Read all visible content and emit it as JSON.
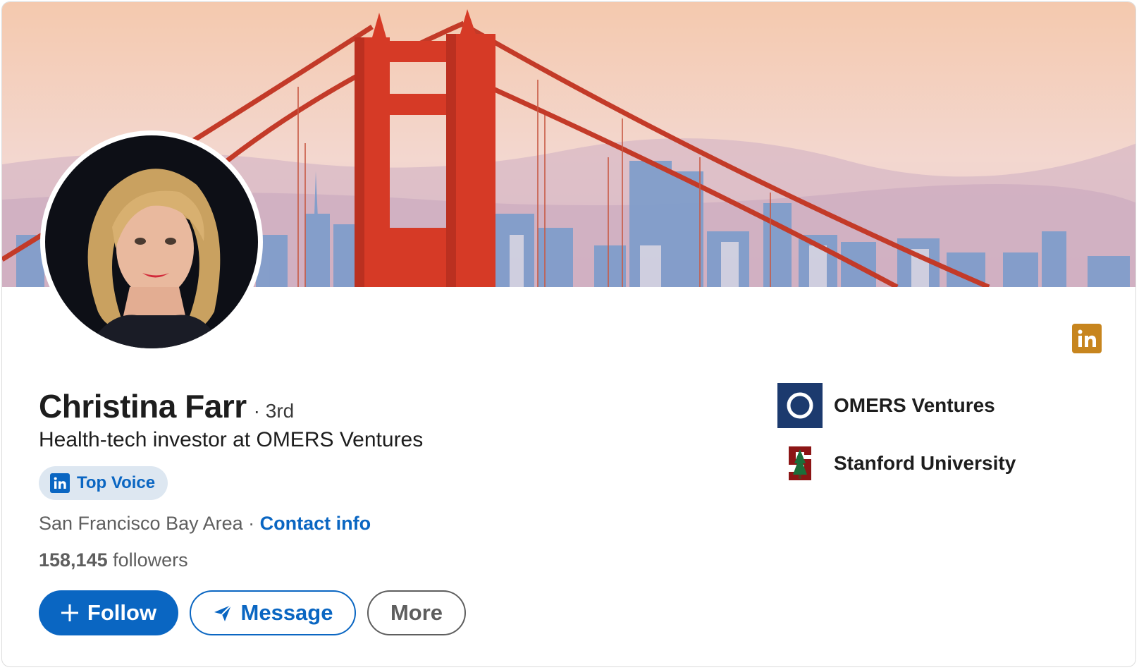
{
  "profile": {
    "name": "Christina Farr",
    "degree": "· 3rd",
    "headline": "Health-tech investor at OMERS Ventures",
    "location": "San Francisco Bay Area",
    "location_separator": " · ",
    "contact_label": "Contact info",
    "followers_count": "158,145",
    "followers_label": " followers"
  },
  "badge": {
    "top_voice_label": "Top Voice",
    "icon": "linkedin-icon"
  },
  "actions": {
    "follow_label": "Follow",
    "follow_icon": "plus-icon",
    "message_label": "Message",
    "message_icon": "paper-plane-icon",
    "more_label": "More"
  },
  "organizations": [
    {
      "name": "OMERS Ventures",
      "icon": "omers-logo"
    },
    {
      "name": "Stanford University",
      "icon": "stanford-logo"
    }
  ],
  "colors": {
    "accent": "#0a66c2",
    "linkedin_gold": "#c7851e",
    "bridge_red": "#d63a26"
  }
}
